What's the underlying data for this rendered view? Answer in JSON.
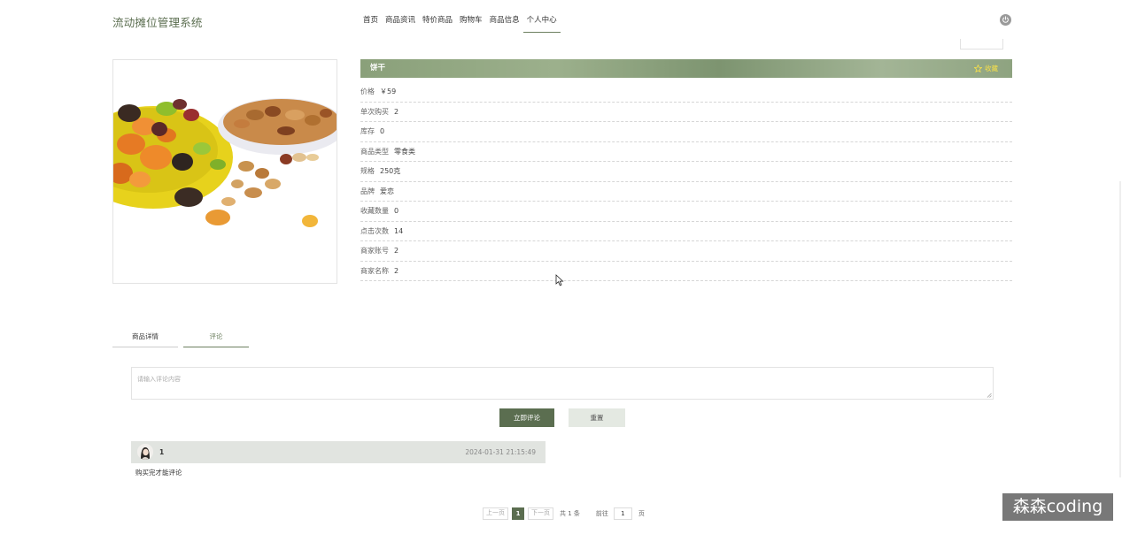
{
  "header": {
    "site_title": "流动摊位管理系统",
    "nav": [
      "首页",
      "商品资讯",
      "特价商品",
      "购物车",
      "商品信息",
      "个人中心"
    ],
    "active_nav": "个人中心",
    "power_icon": "power-icon"
  },
  "product": {
    "name": "饼干",
    "favorite_label": "收藏",
    "favorite_icon": "star-icon",
    "image_alt": "dried fruit and nuts",
    "fields": [
      {
        "label": "价格",
        "value": "￥59"
      },
      {
        "label": "单次购买",
        "value": "2"
      },
      {
        "label": "库存",
        "value": "0"
      },
      {
        "label": "商品类型",
        "value": "零食类"
      },
      {
        "label": "规格",
        "value": "250克"
      },
      {
        "label": "品牌",
        "value": "爱恋"
      },
      {
        "label": "收藏数量",
        "value": "0"
      },
      {
        "label": "点击次数",
        "value": "14"
      },
      {
        "label": "商家账号",
        "value": "2"
      },
      {
        "label": "商家名称",
        "value": "2"
      }
    ]
  },
  "tabs": [
    "商品详情",
    "评论"
  ],
  "active_tab": "评论",
  "comment_form": {
    "placeholder": "请输入评论内容",
    "submit_label": "立即评论",
    "reset_label": "重置"
  },
  "comments": [
    {
      "user": "1",
      "time": "2024-01-31 21:15:49",
      "content": "购买完才能评论"
    }
  ],
  "pagination": {
    "prev": "上一页",
    "current": "1",
    "next": "下一页",
    "total": "共 1 条",
    "goto": "前往",
    "goto_value": "1",
    "unit": "页"
  },
  "watermark": "森森coding",
  "colors": {
    "accent": "#5b6e50",
    "title_bar": "#8aa07a",
    "favorite": "#f6e04a"
  }
}
